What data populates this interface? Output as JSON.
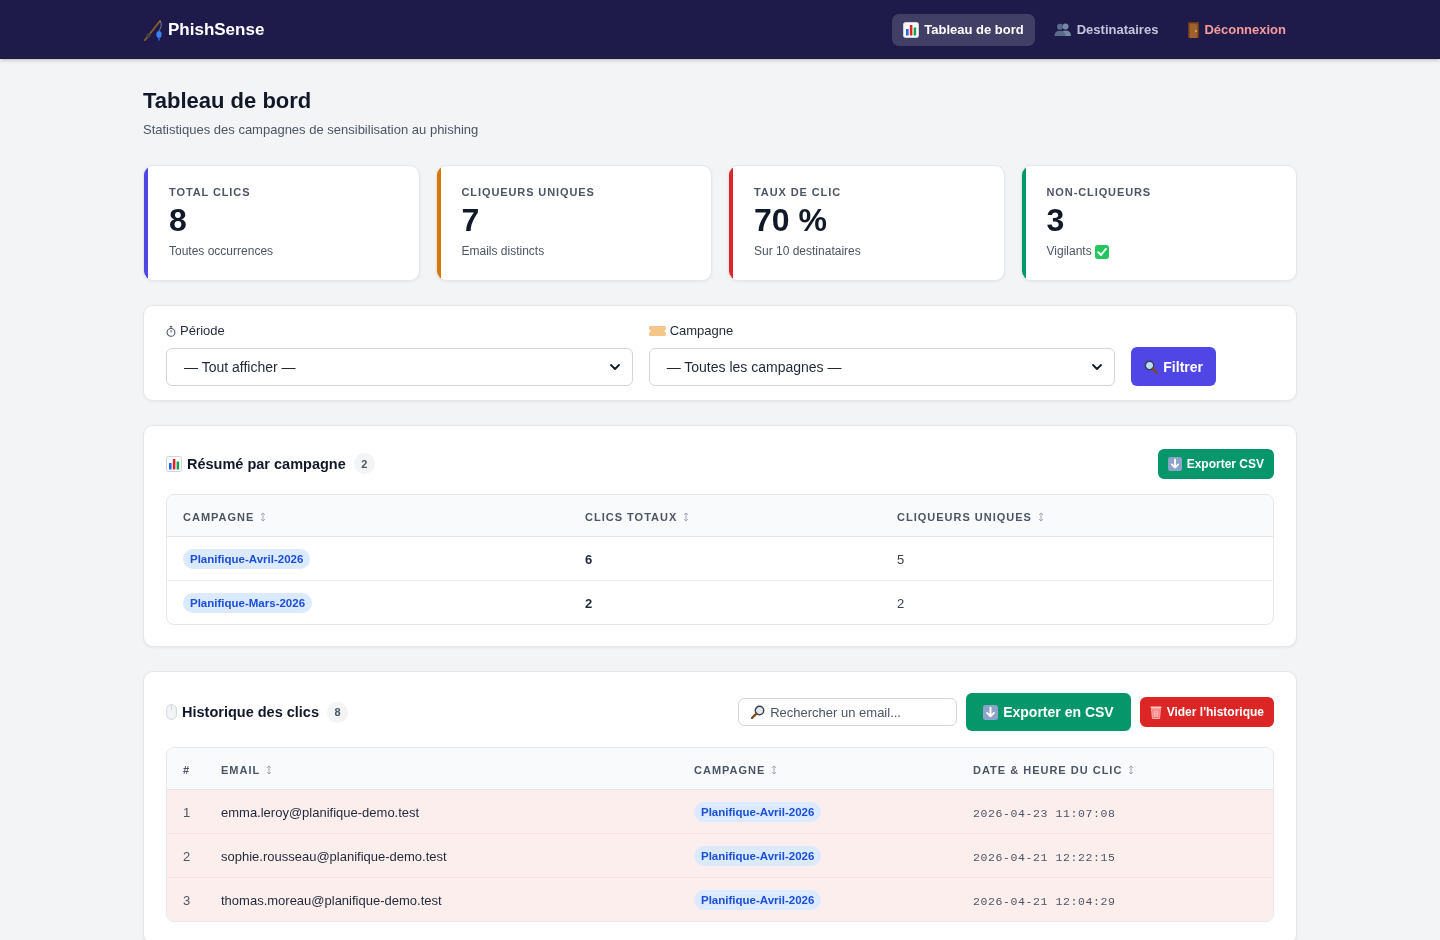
{
  "nav": {
    "brand": "PhishSense",
    "items": [
      {
        "label": "Tableau de bord",
        "kind": "chart",
        "selected": true
      },
      {
        "label": "Destinataires",
        "kind": "people",
        "selected": false
      },
      {
        "label": "Déconnexion",
        "kind": "logout",
        "selected": false
      }
    ]
  },
  "page": {
    "title": "Tableau de bord",
    "subtitle": "Statistiques des campagnes de sensibilisation au phishing"
  },
  "stats": [
    {
      "label": "TOTAL CLICS",
      "value": "8",
      "note": "Toutes occurrences",
      "color": "#4f46e5",
      "check": false
    },
    {
      "label": "CLIQUEURS UNIQUES",
      "value": "7",
      "note": "Emails distincts",
      "color": "#d97706",
      "check": false
    },
    {
      "label": "TAUX DE CLIC",
      "value": "70 %",
      "note": "Sur 10 destinataires",
      "color": "#dc2626",
      "check": false
    },
    {
      "label": "NON-CLIQUEURS",
      "value": "3",
      "note": "Vigilants",
      "color": "#059669",
      "check": true
    }
  ],
  "filters": {
    "fields": [
      {
        "label": "Période",
        "kind": "period",
        "value": "— Tout afficher —"
      },
      {
        "label": "Campagne",
        "kind": "campaign",
        "value": "— Toutes les campagnes —"
      }
    ],
    "button": "Filtrer"
  },
  "summary": {
    "title": "Résumé par campagne",
    "count": "2",
    "export_button": "Exporter CSV",
    "columns": [
      {
        "label": "CAMPAGNE",
        "sortable": true
      },
      {
        "label": "CLICS TOTAUX",
        "sortable": true
      },
      {
        "label": "CLIQUEURS UNIQUES",
        "sortable": true
      }
    ],
    "rows": [
      {
        "campaign": "Planifique-Avril-2026",
        "clicks": "6",
        "unique_clickers": "5"
      },
      {
        "campaign": "Planifique-Mars-2026",
        "clicks": "2",
        "unique_clickers": "2"
      }
    ]
  },
  "history": {
    "title": "Historique des clics",
    "count": "8",
    "search": {
      "placeholder": "Rechercher un email..."
    },
    "export_button": "Exporter en CSV",
    "clear_button": "Vider l'historique",
    "columns": [
      {
        "label": "#",
        "sortable": false
      },
      {
        "label": "EMAIL",
        "sortable": true
      },
      {
        "label": "CAMPAGNE",
        "sortable": true
      },
      {
        "label": "DATE & HEURE DU CLIC",
        "sortable": true
      }
    ],
    "rows": [
      {
        "number": "1",
        "email": "emma.leroy@planifique-demo.test",
        "campaign": "Planifique-Avril-2026",
        "date": "2026-04-23 11:07:08",
        "highlighted": true
      },
      {
        "number": "2",
        "email": "sophie.rousseau@planifique-demo.test",
        "campaign": "Planifique-Avril-2026",
        "date": "2026-04-21 12:22:15",
        "highlighted": true
      },
      {
        "number": "3",
        "email": "thomas.moreau@planifique-demo.test",
        "campaign": "Planifique-Avril-2026",
        "date": "2026-04-21 12:04:29",
        "highlighted": true
      }
    ]
  }
}
